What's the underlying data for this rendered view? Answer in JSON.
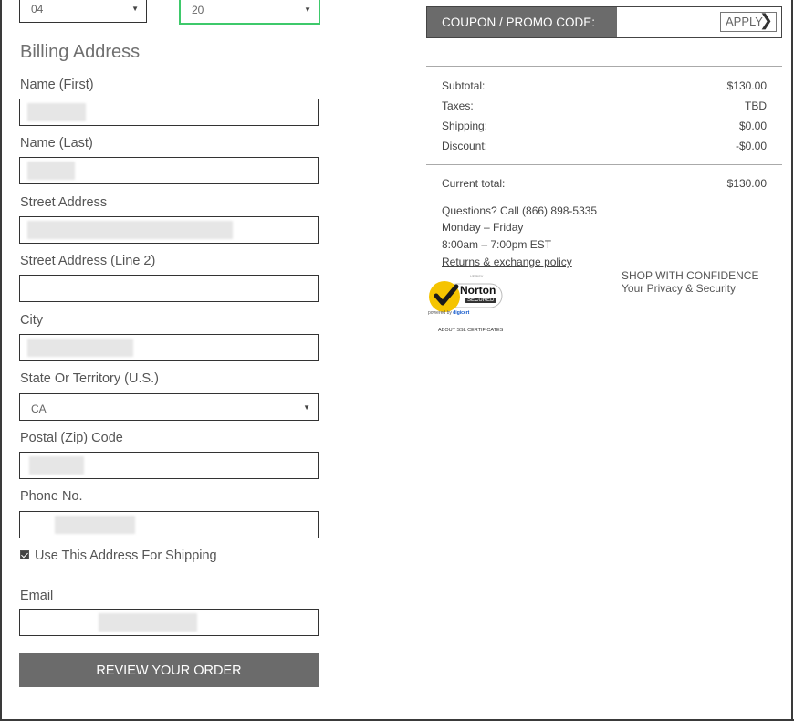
{
  "expiry": {
    "month": "04",
    "year": "20"
  },
  "billing": {
    "heading": "Billing Address",
    "first_name_label": "Name (First)",
    "last_name_label": "Name (Last)",
    "street_label": "Street Address",
    "street2_label": "Street Address (Line 2)",
    "city_label": "City",
    "state_label": "State Or Territory (U.S.)",
    "state_value": "CA",
    "zip_label": "Postal (Zip) Code",
    "phone_label": "Phone No.",
    "use_for_shipping_label": "Use This Address For Shipping",
    "use_for_shipping_checked": true,
    "email_label": "Email",
    "review_button": "REVIEW YOUR ORDER"
  },
  "coupon": {
    "label": "COUPON / PROMO CODE:",
    "apply_button": "APPLY"
  },
  "summary": {
    "subtotal_label": "Subtotal:",
    "subtotal": "$130.00",
    "taxes_label": "Taxes:",
    "taxes": "TBD",
    "shipping_label": "Shipping:",
    "shipping": "$0.00",
    "discount_label": "Discount:",
    "discount": "-$0.00",
    "total_label": "Current total:",
    "total": "$130.00"
  },
  "support": {
    "questions": "Questions? Call (866) 898-5335",
    "days": "Monday – Friday",
    "hours": "8:00am – 7:00pm EST",
    "returns_link": "Returns & exchange policy"
  },
  "norton": {
    "verify": "VERIFY",
    "brand": "Norton",
    "secured": "SECURED",
    "powered_by": "powered by",
    "digicert": "digicert",
    "ssl_link": "ABOUT SSL CERTIFICATES"
  },
  "confidence": {
    "line1": "SHOP WITH CONFIDENCE",
    "line2": "Your Privacy & Security"
  },
  "colors": {
    "accent_focus": "#3ec96b",
    "button_bg": "#6b6b6b",
    "norton_yellow": "#f5c400"
  }
}
